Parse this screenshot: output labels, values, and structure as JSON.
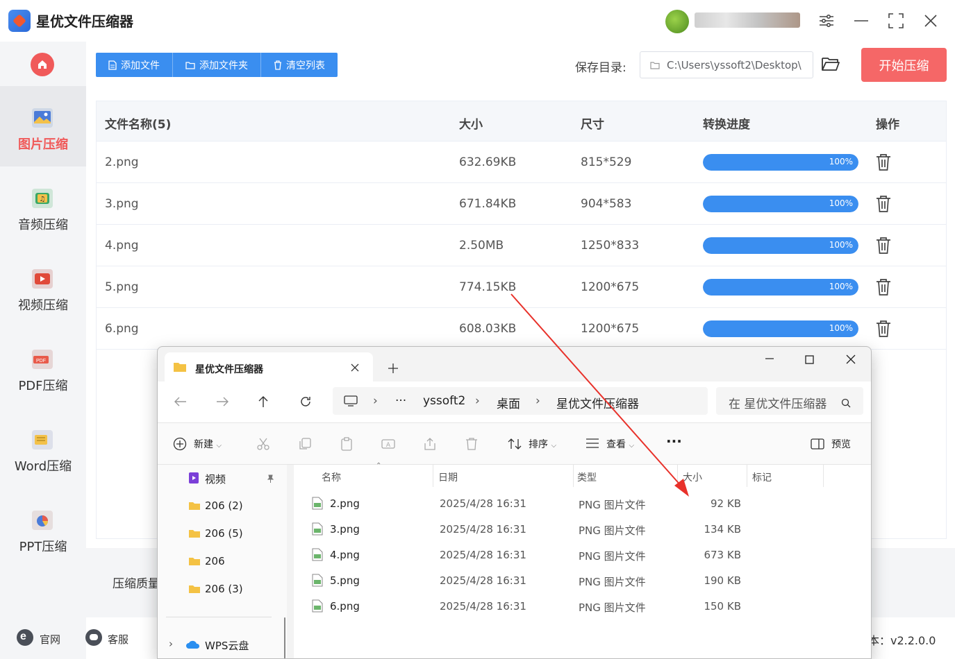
{
  "app": {
    "title": "星优文件压缩器",
    "version": "本：v2.2.0.0"
  },
  "sidebar": {
    "items": [
      {
        "label": "图片压缩",
        "icon": "image-icon",
        "active": true
      },
      {
        "label": "音频压缩",
        "icon": "audio-icon"
      },
      {
        "label": "视频压缩",
        "icon": "video-icon"
      },
      {
        "label": "PDF压缩",
        "icon": "pdf-icon"
      },
      {
        "label": "Word压缩",
        "icon": "word-icon"
      },
      {
        "label": "PPT压缩",
        "icon": "ppt-icon"
      }
    ],
    "footer": {
      "website": "官网",
      "service": "客服"
    }
  },
  "toolbar": {
    "add_file": "添加文件",
    "add_folder": "添加文件夹",
    "clear_list": "清空列表"
  },
  "save": {
    "label": "保存目录:",
    "path": "C:\\Users\\yssoft2\\Desktop\\"
  },
  "start_button": "开始压缩",
  "table": {
    "headers": {
      "name": "文件名称(5)",
      "size": "大小",
      "dims": "尺寸",
      "progress": "转换进度",
      "action": "操作"
    },
    "rows": [
      {
        "name": "2.png",
        "size": "632.69KB",
        "dims": "815*529",
        "progress": "100%",
        "progress_value": 1.0
      },
      {
        "name": "3.png",
        "size": "671.84KB",
        "dims": "904*583",
        "progress": "100%",
        "progress_value": 1.0
      },
      {
        "name": "4.png",
        "size": "2.50MB",
        "dims": "1250*833",
        "progress": "100%",
        "progress_value": 1.0
      },
      {
        "name": "5.png",
        "size": "774.15KB",
        "dims": "1200*675",
        "progress": "100%",
        "progress_value": 1.0
      },
      {
        "name": "6.png",
        "size": "608.03KB",
        "dims": "1200*675",
        "progress": "100%",
        "progress_value": 1.0
      }
    ]
  },
  "settings": {
    "quality_label": "压缩质量"
  },
  "explorer": {
    "tab_title": "星优文件压缩器",
    "breadcrumb": [
      "yssoft2",
      "桌面",
      "星优文件压缩器"
    ],
    "search_placeholder": "在 星优文件压缩器",
    "commands": {
      "new": "新建",
      "sort": "排序",
      "view": "查看",
      "preview": "预览"
    },
    "nav": [
      {
        "label": "视频",
        "icon": "video-folder-icon"
      },
      {
        "label": "206 (2)",
        "icon": "folder-icon"
      },
      {
        "label": "206 (5)",
        "icon": "folder-icon"
      },
      {
        "label": "206",
        "icon": "folder-icon"
      },
      {
        "label": "206 (3)",
        "icon": "folder-icon"
      },
      {
        "label": "WPS云盘",
        "icon": "cloud-icon"
      }
    ],
    "columns": {
      "name": "名称",
      "date": "日期",
      "type": "类型",
      "size": "大小",
      "tag": "标记"
    },
    "files": [
      {
        "name": "2.png",
        "date": "2025/4/28 16:31",
        "type": "PNG 图片文件",
        "size": "92 KB"
      },
      {
        "name": "3.png",
        "date": "2025/4/28 16:31",
        "type": "PNG 图片文件",
        "size": "134 KB"
      },
      {
        "name": "4.png",
        "date": "2025/4/28 16:31",
        "type": "PNG 图片文件",
        "size": "673 KB"
      },
      {
        "name": "5.png",
        "date": "2025/4/28 16:31",
        "type": "PNG 图片文件",
        "size": "190 KB"
      },
      {
        "name": "6.png",
        "date": "2025/4/28 16:31",
        "type": "PNG 图片文件",
        "size": "150 KB"
      }
    ]
  },
  "colors": {
    "accent": "#3a8ef0",
    "danger": "#f56767",
    "arrow": "#e8312a"
  }
}
